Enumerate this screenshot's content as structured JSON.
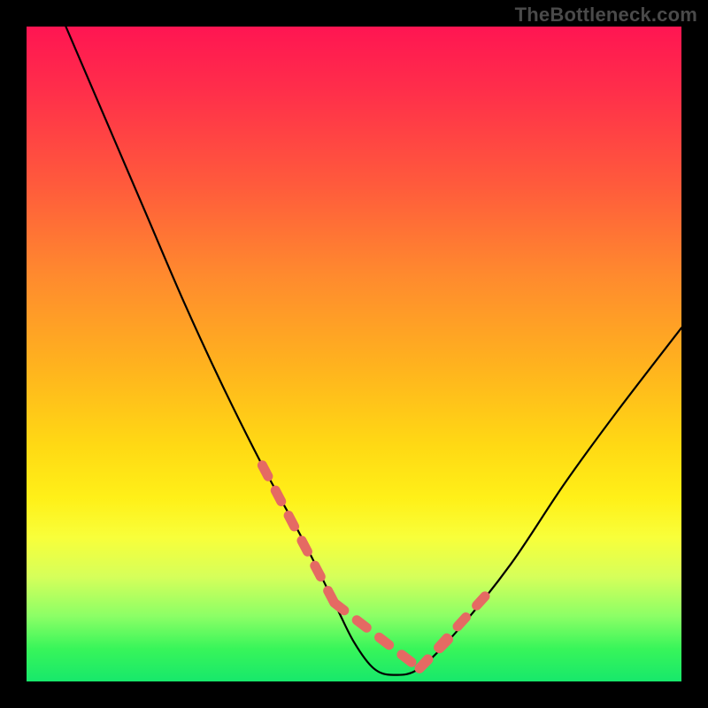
{
  "watermark": "TheBottleneck.com",
  "chart_data": {
    "type": "line",
    "title": "",
    "xlabel": "",
    "ylabel": "",
    "xlim": [
      0,
      100
    ],
    "ylim": [
      0,
      100
    ],
    "grid": false,
    "legend": false,
    "series": [
      {
        "name": "bottleneck-curve",
        "color": "#000000",
        "x": [
          6,
          12,
          18,
          24,
          30,
          36,
          42,
          47,
          50,
          53,
          56,
          60,
          66,
          74,
          82,
          90,
          100
        ],
        "y": [
          100,
          86,
          72,
          58,
          45,
          33,
          22,
          12,
          6,
          2,
          1,
          2,
          8,
          18,
          30,
          41,
          54
        ]
      },
      {
        "name": "highlighted-segments",
        "color": "#e56a63",
        "style": "dashed-thick",
        "segments": [
          {
            "x": [
              36,
              47
            ],
            "y": [
              33,
              12
            ]
          },
          {
            "x": [
              47,
              60
            ],
            "y": [
              12,
              2
            ]
          },
          {
            "x": [
              60,
              66
            ],
            "y": [
              2,
              8
            ]
          },
          {
            "x": [
              60,
              70
            ],
            "y": [
              2,
              13
            ]
          }
        ]
      }
    ],
    "gradient_stops": [
      {
        "pos": 0,
        "color": "#ff1552"
      },
      {
        "pos": 10,
        "color": "#ff2f4a"
      },
      {
        "pos": 24,
        "color": "#ff5a3c"
      },
      {
        "pos": 38,
        "color": "#ff8a2e"
      },
      {
        "pos": 52,
        "color": "#ffb31e"
      },
      {
        "pos": 64,
        "color": "#ffd914"
      },
      {
        "pos": 72,
        "color": "#fff018"
      },
      {
        "pos": 78,
        "color": "#f8ff3a"
      },
      {
        "pos": 84,
        "color": "#d6ff5a"
      },
      {
        "pos": 90,
        "color": "#8cff66"
      },
      {
        "pos": 95,
        "color": "#38f55a"
      },
      {
        "pos": 100,
        "color": "#17e86b"
      }
    ]
  }
}
